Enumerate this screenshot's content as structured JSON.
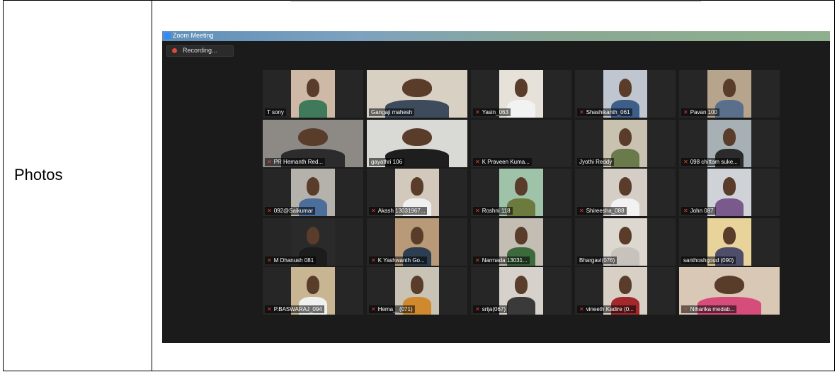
{
  "document": {
    "row_label": "Photos"
  },
  "zoom": {
    "window_title": "Zoom Meeting",
    "recording_label": "Recording...",
    "tiles": [
      {
        "name": "T sony",
        "muted": false,
        "active": false,
        "face": "#cdb9a6",
        "shirt": "#3f7a5a"
      },
      {
        "name": "Gangaji mahesh",
        "muted": false,
        "active": true,
        "face": "#d8d0c3",
        "shirt": "#3d4b5c"
      },
      {
        "name": "Yasin_063",
        "muted": true,
        "active": false,
        "face": "#e6e2da",
        "shirt": "#f2f2f2"
      },
      {
        "name": "Shashikanth_061",
        "muted": true,
        "active": false,
        "face": "#bfc6cf",
        "shirt": "#3e5e8a"
      },
      {
        "name": "Pavan 100",
        "muted": true,
        "active": false,
        "face": "#b7a48c",
        "shirt": "#5a6f8c"
      },
      {
        "name": "PR Hemanth Red...",
        "muted": true,
        "active": false,
        "face": "#8d8a86",
        "shirt": "#2c2c2c"
      },
      {
        "name": "gayathri 106",
        "muted": false,
        "active": false,
        "face": "#d9d9d6",
        "shirt": "#1e1e1e"
      },
      {
        "name": "K Praveen Kuma...",
        "muted": true,
        "active": false,
        "face": "#262626",
        "shirt": "#262626"
      },
      {
        "name": "Jyothi Reddy",
        "muted": false,
        "active": false,
        "face": "#c9c2b0",
        "shirt": "#6a7a4b"
      },
      {
        "name": "098 chittam suke...",
        "muted": true,
        "active": false,
        "face": "#a7b1b5",
        "shirt": "#2b2b2b"
      },
      {
        "name": "092@Saikumar",
        "muted": true,
        "active": false,
        "face": "#b5b2ab",
        "shirt": "#4b6e9a"
      },
      {
        "name": "Akash 13031967...",
        "muted": true,
        "active": false,
        "face": "#d2c8bb",
        "shirt": "#f0f0f0"
      },
      {
        "name": "Roshni 118",
        "muted": true,
        "active": false,
        "face": "#9fc3a9",
        "shirt": "#6b7b3e"
      },
      {
        "name": "Shireesha_088",
        "muted": true,
        "active": false,
        "face": "#d4cec6",
        "shirt": "#f2f2f2"
      },
      {
        "name": "John 087",
        "muted": true,
        "active": false,
        "face": "#cfd2d6",
        "shirt": "#7a5a8c"
      },
      {
        "name": "M Dhanush 081",
        "muted": true,
        "active": false,
        "face": "#2a2a2a",
        "shirt": "#1c1c1c"
      },
      {
        "name": "K Yashwanth Go...",
        "muted": true,
        "active": false,
        "face": "#b89a78",
        "shirt": "#2c3e50"
      },
      {
        "name": "Narmada 13031...",
        "muted": true,
        "active": false,
        "face": "#c4bdb3",
        "shirt": "#3c6a3c"
      },
      {
        "name": "Bhargavi(076)",
        "muted": false,
        "active": false,
        "face": "#dcd8d0",
        "shirt": "#c7c2bb"
      },
      {
        "name": "santhoshgoud (090)",
        "muted": false,
        "active": false,
        "face": "#e8d39b",
        "shirt": "#4e4e6a"
      },
      {
        "name": "P.BASWARAJ_094",
        "muted": true,
        "active": false,
        "face": "#c8b692",
        "shirt": "#f0f0f0"
      },
      {
        "name": "Hema__(071)",
        "muted": true,
        "active": false,
        "face": "#c9c3b6",
        "shirt": "#d0892d"
      },
      {
        "name": "srija(067)",
        "muted": true,
        "active": false,
        "face": "#d6d2cb",
        "shirt": "#3a3a3a"
      },
      {
        "name": "vineeth Kadire (0...",
        "muted": true,
        "active": false,
        "face": "#d8d0c4",
        "shirt": "#a3282c"
      },
      {
        "name": "Niharika medab...",
        "muted": true,
        "active": false,
        "face": "#d9c8b6",
        "shirt": "#d64c7a"
      }
    ]
  }
}
